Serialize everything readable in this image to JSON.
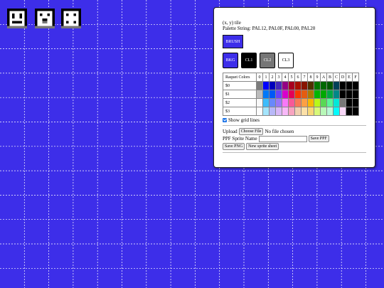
{
  "panel": {
    "tile_label": "(x, y) tile",
    "palette_string": "Palette String: PAL12, PAL0F, PAL00, PAL20",
    "brush_label": "BRUSH",
    "color_buttons": [
      {
        "label": "BKG",
        "bg": "#3d2ee9",
        "fg": "#ffffff"
      },
      {
        "label": "CL1",
        "bg": "#000000",
        "fg": "#ffffff"
      },
      {
        "label": "CL2",
        "bg": "#767676",
        "fg": "#ffffff"
      },
      {
        "label": "CL3",
        "bg": "#ffffff",
        "fg": "#000000"
      }
    ],
    "table_header": "Raquet Colors",
    "columns": [
      "0",
      "1",
      "2",
      "3",
      "4",
      "5",
      "6",
      "7",
      "8",
      "9",
      "A",
      "B",
      "C",
      "D",
      "E",
      "F"
    ],
    "rows": [
      {
        "label": "$0",
        "colors": [
          "#7c7c7c",
          "#0000fc",
          "#0000bc",
          "#4428bc",
          "#940084",
          "#a80020",
          "#a81000",
          "#881400",
          "#503000",
          "#007800",
          "#006800",
          "#005800",
          "#004058",
          "#000000",
          "#000000",
          "#000000"
        ]
      },
      {
        "label": "$1",
        "colors": [
          "#bcbcbc",
          "#0078f8",
          "#0058f8",
          "#6844fc",
          "#d800cc",
          "#e40058",
          "#f83800",
          "#e45c10",
          "#ac7c00",
          "#00b800",
          "#00a800",
          "#00a844",
          "#008888",
          "#000000",
          "#000000",
          "#000000"
        ]
      },
      {
        "label": "$2",
        "colors": [
          "#f8f8f8",
          "#3cbcfc",
          "#6888fc",
          "#9878f8",
          "#f878f8",
          "#f85898",
          "#f87858",
          "#fca044",
          "#f8b800",
          "#b8f818",
          "#58d854",
          "#58f898",
          "#00e8d8",
          "#787878",
          "#000000",
          "#000000"
        ]
      },
      {
        "label": "$3",
        "colors": [
          "#fcfcfc",
          "#a4e4fc",
          "#b8b8f8",
          "#d8b8f8",
          "#f8b8f8",
          "#f8a4c0",
          "#f0d0b0",
          "#fce0a8",
          "#f8d878",
          "#d8f878",
          "#b8f8b8",
          "#b8f8d8",
          "#00fcfc",
          "#f8d8f8",
          "#000000",
          "#000000"
        ]
      }
    ],
    "show_grid_label": "Show grid lines",
    "upload_label": "Upload",
    "choose_file_label": "Choose File",
    "no_file_label": "No file chosen",
    "sprite_name_label": "PPF Sprite Name",
    "sprite_name_value": "",
    "save_ppf_label": "Save PPF",
    "save_png_label": "Save PNG",
    "new_sheet_label": "New sprite sheet"
  },
  "colors": {
    "canvas_bg": "#3d2ee9",
    "grid_line": "#ffffff"
  }
}
